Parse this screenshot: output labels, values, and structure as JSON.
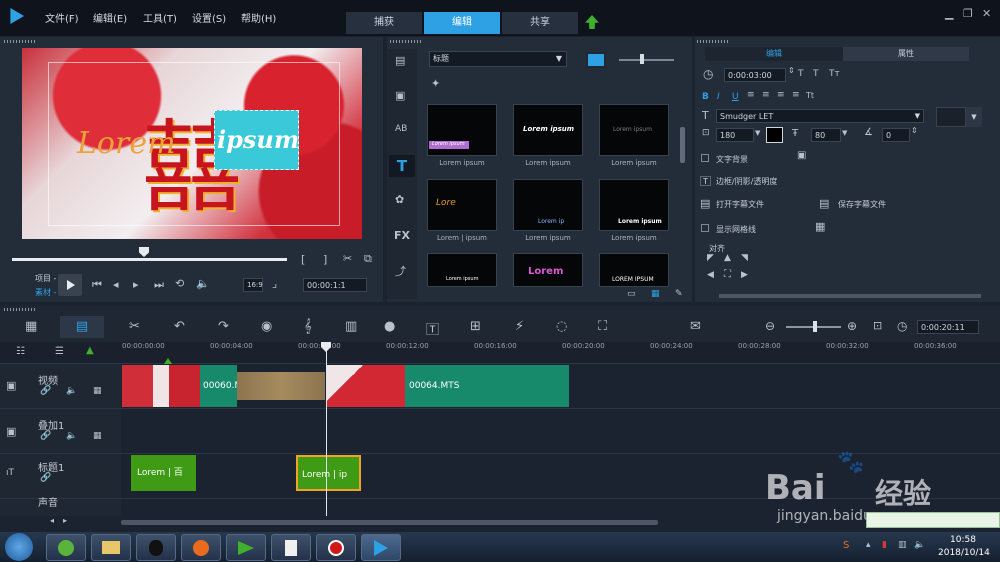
{
  "menu": {
    "file": "文件(F)",
    "edit": "编辑(E)",
    "tools": "工具(T)",
    "settings": "设置(S)",
    "help": "帮助(H)"
  },
  "tabs": {
    "capture": "捕获",
    "edit": "编辑",
    "share": "共享"
  },
  "preview": {
    "overlay_text_1": "Lorem",
    "overlay_text_2": "ipsum",
    "mode_project": "项目 -",
    "mode_clip": "素材 -",
    "aspect": "16:9",
    "timecode": "00:00:1:1"
  },
  "library": {
    "category": "标题",
    "thumbs": [
      {
        "text": "Lorem ipsum",
        "caption": "Lorem ipsum"
      },
      {
        "text": "Lorem ipsum",
        "caption": "Lorem ipsum"
      },
      {
        "text": "Lorem ipsum",
        "caption": "Lorem ipsum"
      },
      {
        "text": "Lore",
        "caption": "Lorem | ipsum"
      },
      {
        "text": "Lorem ip",
        "caption": "Lorem ipsum"
      },
      {
        "text": "Lorem ipsum",
        "caption": "Lorem ipsum"
      },
      {
        "text": "Lorem ipsum",
        "caption": ""
      },
      {
        "text": "Lorem",
        "caption": ""
      },
      {
        "text": "LOREM IPSUM",
        "caption": ""
      }
    ],
    "side_icons": [
      "media-icon",
      "instant-project-icon",
      "transition-icon",
      "title-icon",
      "graphic-icon",
      "fx-label",
      "path-icon"
    ],
    "fx_label": "FX"
  },
  "options": {
    "tab_edit": "编辑",
    "tab_attr": "属性",
    "duration": "0:00:03:00",
    "font": "Smudger LET",
    "font_size": "180",
    "line_spacing": "80",
    "angle": "0",
    "text_bg": "文字背景",
    "border_shadow": "边框/阴影/透明度",
    "open_subtitle": "打开字幕文件",
    "save_subtitle": "保存字幕文件",
    "show_grid": "显示网格线",
    "align": "对齐",
    "bold": "B",
    "italic": "I",
    "underline": "U"
  },
  "timeline": {
    "total_time": "0:00:20:11",
    "ruler": [
      "00:00:00:00",
      "00:00:04:00",
      "00:00:08:00",
      "00:00:12:00",
      "00:00:16:00",
      "00:00:20:00",
      "00:00:24:00",
      "00:00:28:00",
      "00:00:32:00",
      "00:00:36:00"
    ],
    "tracks": {
      "video": "视频",
      "overlay": "叠加1",
      "title": "标题1",
      "audio": "声音"
    },
    "clips": {
      "video1": "00060.M",
      "video2": "00064.MTS",
      "title1": "Lorem | 百",
      "title2": "Lorem | ip"
    }
  },
  "watermark": {
    "brand": "Bai",
    "brand2": "经验",
    "url": "jingyan.baidu.com"
  },
  "taskbar": {
    "time": "10:58",
    "date": "2018/10/14"
  },
  "colors": {
    "accent": "#2ea0e4",
    "clip_green": "#178a6c",
    "title_green": "#3f9a16",
    "playhead": "#e0e6ee"
  }
}
